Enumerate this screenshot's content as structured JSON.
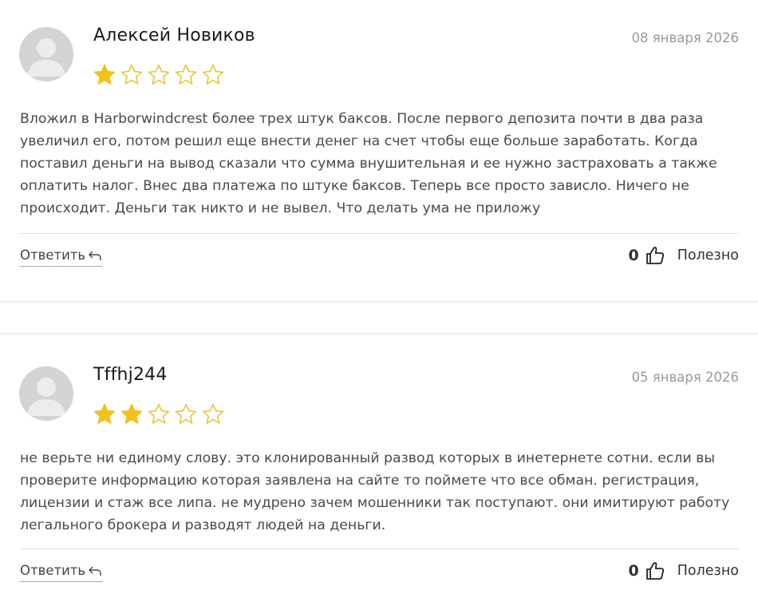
{
  "reviews": [
    {
      "author": "Алексей Новиков",
      "date": "08 января 2026",
      "rating": 1,
      "max_rating": 5,
      "text": "Вложил в Harborwindcrest более трех штук баксов. После первого депозита почти в два раза увеличил его, потом решил еще внести денег на счет чтобы еще больше заработать. Когда поставил деньги на вывод сказали что сумма внушительная и ее нужно застраховать а также оплатить налог. Внес два платежа по штуке баксов. Теперь все просто зависло. Ничего не происходит. Деньги так никто и не вывел. Что делать ума не приложу",
      "reply_label": "Ответить",
      "helpful_count": "0",
      "helpful_label": "Полезно"
    },
    {
      "author": "Tffhj244",
      "date": "05 января 2026",
      "rating": 2,
      "max_rating": 5,
      "text": "не верьте ни единому слову. это клонированный развод которых в инетернете сотни. если вы проверите информацию которая заявлена на сайте то поймете что все обман. регистрация, лицензии и стаж все липа. не мудрено зачем мошенники так поступают. они имитируют работу легального брокера и разводят людей на деньги.",
      "reply_label": "Ответить",
      "helpful_count": "0",
      "helpful_label": "Полезно"
    }
  ],
  "colors": {
    "star_filled": "#f2c21b",
    "star_outline": "#e8c53a",
    "avatar_bg": "#d4d4d4",
    "date": "#9a9a9a",
    "divider": "#e2e2e2"
  },
  "icons": {
    "avatar": "user-placeholder-icon",
    "star": "star-icon",
    "reply": "reply-arrow-icon",
    "helpful": "thumbs-up-icon"
  }
}
